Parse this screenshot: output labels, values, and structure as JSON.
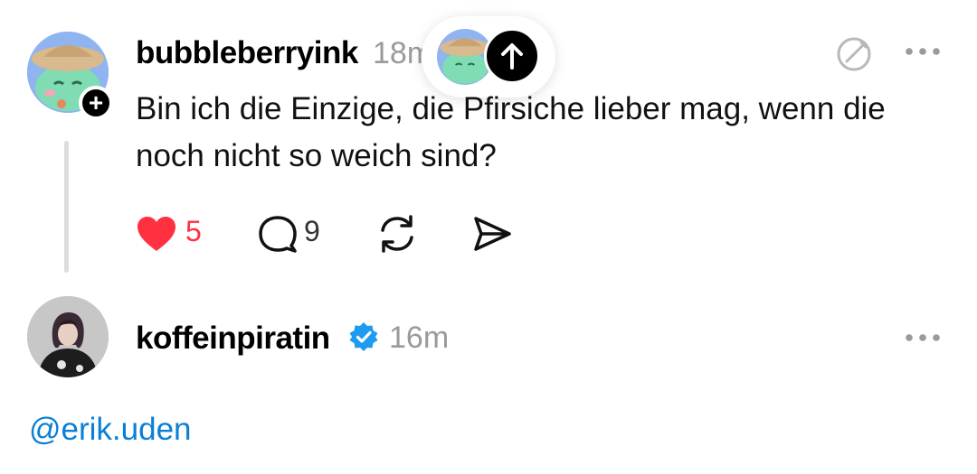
{
  "posts": [
    {
      "username": "bubbleberryink",
      "time": "18m",
      "text": "Bin ich die Einzige, die Pfirsiche lieber mag, wenn die noch nicht so weich sind?",
      "likes": "5",
      "comments": "9",
      "avatar": "green-frog-with-hat-avatar",
      "liked": true,
      "like_color": "#ff3040"
    },
    {
      "username": "koffeinpiratin",
      "time": "16m",
      "verified": true,
      "verified_color": "#1d9bf0",
      "avatar": "woman-with-dark-hair-avatar"
    }
  ],
  "reply": {
    "mention": "@erik.uden",
    "mention_color": "#0a7fd6"
  },
  "icons": {
    "follow": "plus-icon",
    "new_posts": "arrow-up-icon",
    "edit": "edit-icon",
    "more": "more-dots-icon",
    "like": "heart-icon",
    "comment": "comment-icon",
    "repost": "repost-icon",
    "share": "send-icon",
    "verified": "verified-badge-icon"
  }
}
